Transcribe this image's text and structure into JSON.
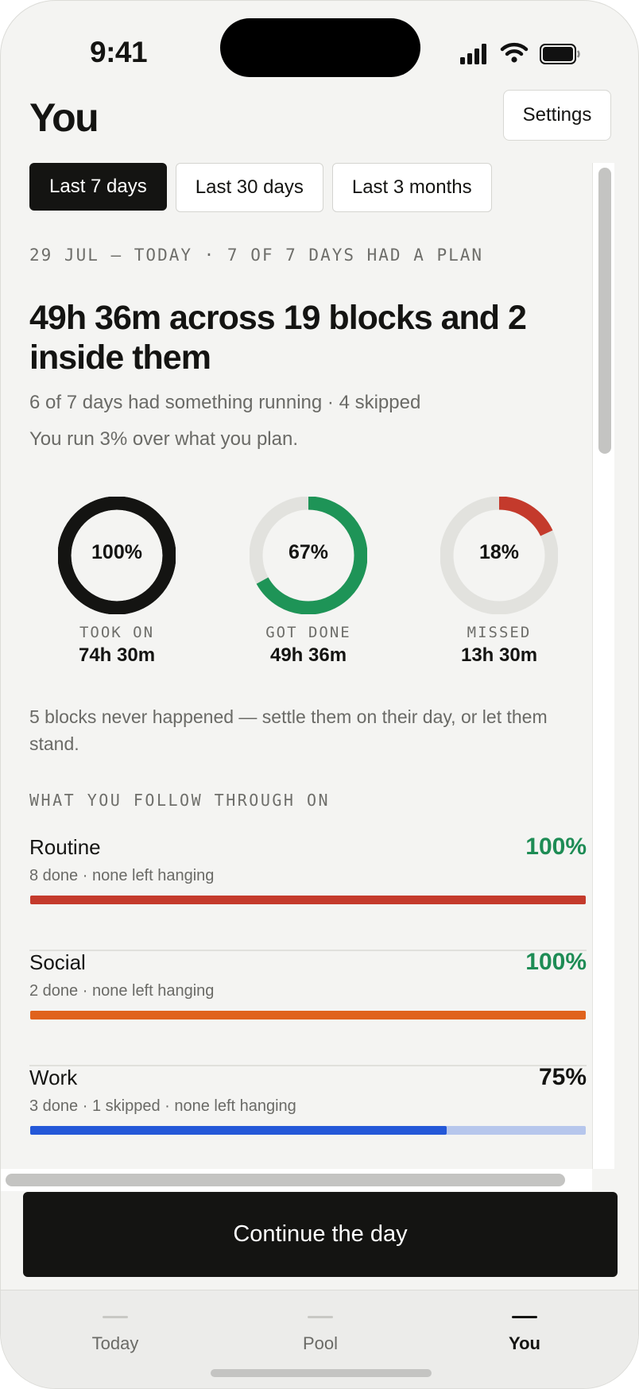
{
  "status_bar": {
    "time": "9:41"
  },
  "header": {
    "title": "You",
    "settings_label": "Settings"
  },
  "filters": [
    {
      "label": "Last 7 days",
      "active": true
    },
    {
      "label": "Last 30 days",
      "active": false
    },
    {
      "label": "Last 3 months",
      "active": false
    }
  ],
  "summary": {
    "range_line": "29 JUL — TODAY · 7 OF 7 DAYS HAD A PLAN",
    "headline": "49h 36m across 19 blocks and 2 inside them",
    "sub_running": "6 of 7 days had something running · 4 skipped",
    "sub_plan": "You run 3% over what you plan."
  },
  "rings": [
    {
      "percent_label": "100%",
      "fraction": 1.0,
      "caption": "TOOK ON",
      "value": "74h 30m",
      "color": "#141412",
      "track_color": "#141412"
    },
    {
      "percent_label": "67%",
      "fraction": 0.67,
      "caption": "GOT DONE",
      "value": "49h 36m",
      "color": "#1e9457",
      "track_color": "#e2e2de"
    },
    {
      "percent_label": "18%",
      "fraction": 0.18,
      "caption": "MISSED",
      "value": "13h 30m",
      "color": "#c43a2c",
      "track_color": "#e2e2de"
    }
  ],
  "note": "5 blocks never happened — settle them on their day, or let them stand.",
  "follow_through": {
    "label": "WHAT YOU FOLLOW THROUGH ON",
    "categories": [
      {
        "name": "Routine",
        "meta": "8 done · none left hanging",
        "percent_label": "100%",
        "fraction": 1.0,
        "bar_color": "#c43a2c",
        "track_color": "#f0c4be",
        "pct_color": "#1e8c55"
      },
      {
        "name": "Social",
        "meta": "2 done · none left hanging",
        "percent_label": "100%",
        "fraction": 1.0,
        "bar_color": "#e0621c",
        "track_color": "#f6cdb4",
        "pct_color": "#1e8c55"
      },
      {
        "name": "Work",
        "meta": "3 done · 1 skipped · none left hanging",
        "percent_label": "75%",
        "fraction": 0.75,
        "bar_color": "#2458d8",
        "track_color": "#b6c6ec",
        "pct_color": "#141412"
      }
    ]
  },
  "cta_label": "Continue the day",
  "tabs": [
    {
      "label": "Today",
      "active": false
    },
    {
      "label": "Pool",
      "active": false
    },
    {
      "label": "You",
      "active": true
    }
  ]
}
